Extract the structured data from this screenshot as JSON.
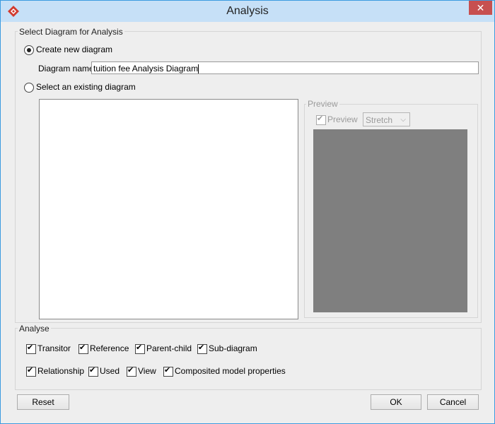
{
  "window": {
    "title": "Analysis",
    "close_glyph": "✕",
    "app_icon": "visual-paradigm-logo-icon"
  },
  "select_section": {
    "title": "Select Diagram for Analysis",
    "create_new_label": "Create new diagram",
    "create_new_checked": true,
    "diagram_name_label": "Diagram name:",
    "diagram_name_value": "tuition fee Analysis Diagram",
    "select_existing_label": "Select an existing diagram",
    "select_existing_checked": false
  },
  "preview": {
    "title": "Preview",
    "checkbox_label": "Preview",
    "checkbox_checked": true,
    "scale_value": "Stretch",
    "enabled": false
  },
  "analyse": {
    "title": "Analyse",
    "row1": [
      {
        "label": "Transitor",
        "checked": true
      },
      {
        "label": "Reference",
        "checked": true
      },
      {
        "label": "Parent-child",
        "checked": true
      },
      {
        "label": "Sub-diagram",
        "checked": true
      }
    ],
    "row2": [
      {
        "label": "Relationship",
        "checked": true
      },
      {
        "label": "Used",
        "checked": true
      },
      {
        "label": "View",
        "checked": true
      },
      {
        "label": "Composited model properties",
        "checked": true
      }
    ]
  },
  "buttons": {
    "reset": "Reset",
    "ok": "OK",
    "cancel": "Cancel"
  },
  "colors": {
    "titlebar": "#c6e0f7",
    "close": "#c75050",
    "preview_bg": "#7f7f7f"
  }
}
